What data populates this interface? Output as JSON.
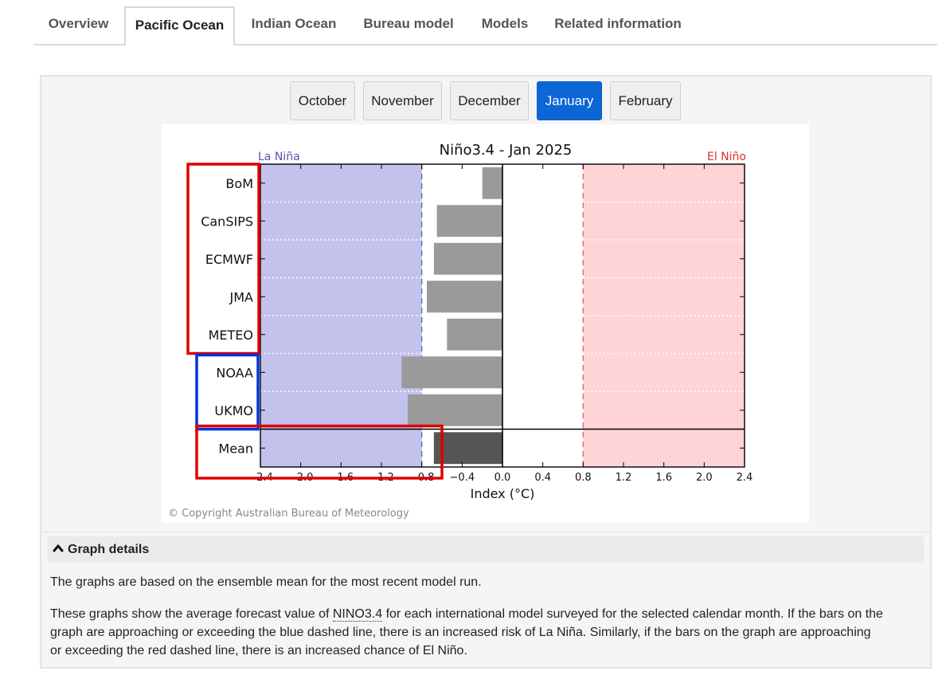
{
  "tabs": [
    {
      "label": "Overview",
      "active": false
    },
    {
      "label": "Pacific Ocean",
      "active": true
    },
    {
      "label": "Indian Ocean",
      "active": false
    },
    {
      "label": "Bureau model",
      "active": false
    },
    {
      "label": "Models",
      "active": false
    },
    {
      "label": "Related information",
      "active": false
    }
  ],
  "months": [
    {
      "label": "October",
      "active": false
    },
    {
      "label": "November",
      "active": false
    },
    {
      "label": "December",
      "active": false
    },
    {
      "label": "January",
      "active": true
    },
    {
      "label": "February",
      "active": false
    }
  ],
  "chart_data": {
    "type": "bar",
    "orientation": "horizontal",
    "title": "Niño3.4 - Jan 2025",
    "xlabel": "Index (°C)",
    "ylabel": "",
    "xlim": [
      -2.4,
      2.4
    ],
    "x_ticks": [
      "−2.4",
      "−2.0",
      "−1.6",
      "−1.2",
      "−0.8",
      "−0.4",
      "0.0",
      "0.4",
      "0.8",
      "1.2",
      "1.6",
      "2.0",
      "2.4"
    ],
    "categories": [
      "BoM",
      "CanSIPS",
      "ECMWF",
      "JMA",
      "METEO",
      "NOAA",
      "UKMO",
      "Mean"
    ],
    "values": [
      -0.2,
      -0.65,
      -0.68,
      -0.75,
      -0.55,
      -1.0,
      -0.94,
      -0.68
    ],
    "bar_colors": [
      "#9a9a9a",
      "#9a9a9a",
      "#9a9a9a",
      "#9a9a9a",
      "#9a9a9a",
      "#9a9a9a",
      "#9a9a9a",
      "#555555"
    ],
    "la_nina_label": "La Niña",
    "el_nino_label": "El Niño",
    "la_nina_threshold": -0.8,
    "el_nino_threshold": 0.8,
    "la_nina_color": "#c2c2ec",
    "el_nino_color": "#ffd4d6",
    "la_nina_text_color": "#5555aa",
    "el_nino_text_color": "#d43333",
    "copyright": "© Copyright Australian Bureau of Meteorology",
    "grid": true,
    "highlight_boxes": [
      {
        "categories": [
          "BoM",
          "CanSIPS",
          "ECMWF",
          "JMA",
          "METEO"
        ],
        "color": "#e00000"
      },
      {
        "categories": [
          "NOAA",
          "UKMO"
        ],
        "color": "#0033dd"
      },
      {
        "categories": [
          "Mean"
        ],
        "color": "#e00000"
      }
    ]
  },
  "details": {
    "heading": "Graph details",
    "para1": "The graphs are based on the ensemble mean for the most recent model run.",
    "para2_before": "These graphs show the average forecast value of ",
    "para2_abbr": "NINO3.4",
    "para2_line1_after": " for each international model surveyed for the selected calendar month. If the bars on the",
    "para2_line2": "graph are approaching or exceeding the blue dashed line, there is an increased risk of La Niña. Similarly, if the bars on the graph are approaching",
    "para2_line3": "or exceeding the red dashed line, there is an increased chance of El Niño."
  }
}
